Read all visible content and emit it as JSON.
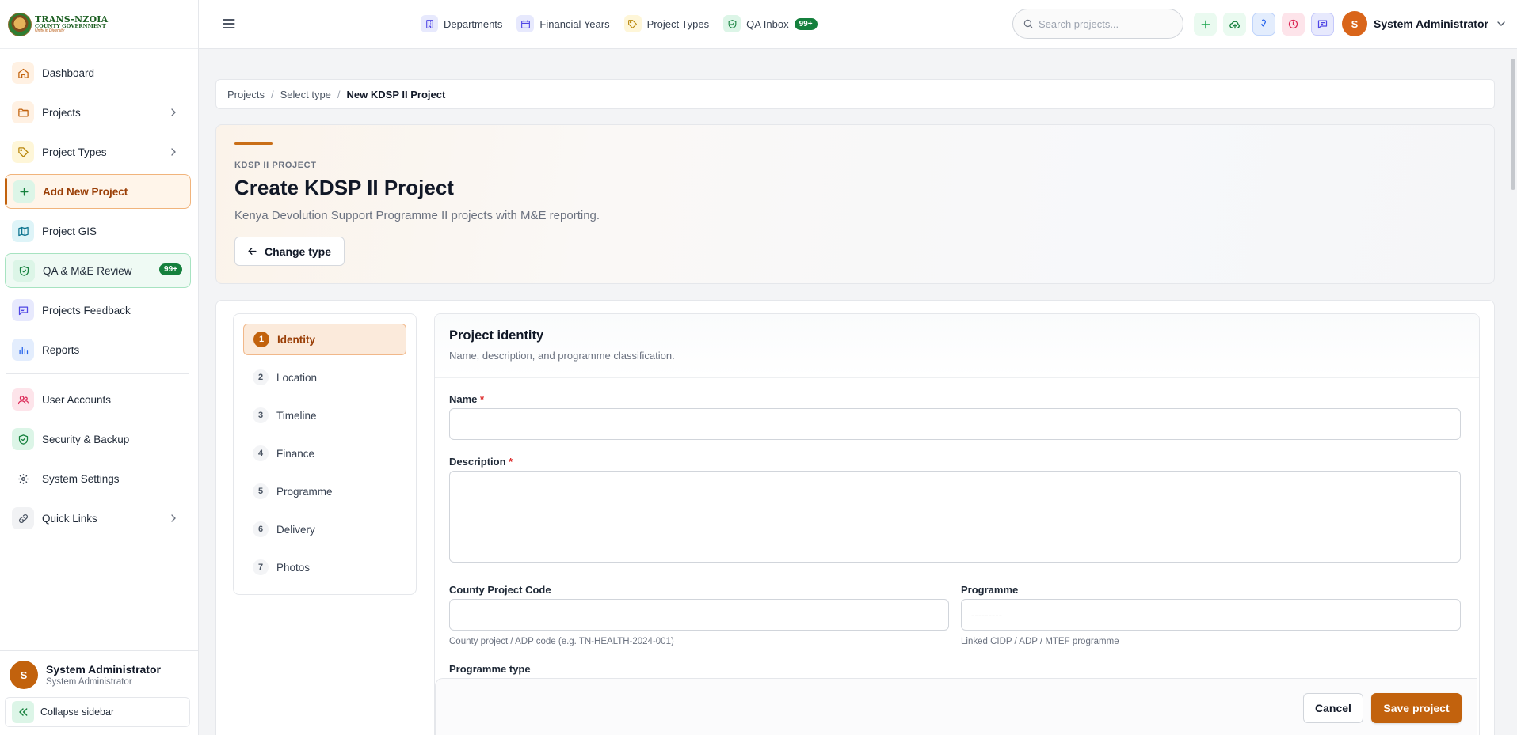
{
  "brand": {
    "line1": "TRANS-NZOIA",
    "line2": "COUNTY GOVERNMENT",
    "line3": "Unity in Diversity"
  },
  "sidebar": {
    "items": [
      {
        "label": "Dashboard",
        "icon": "home-icon"
      },
      {
        "label": "Projects",
        "icon": "folder-icon"
      },
      {
        "label": "Project Types",
        "icon": "tag-icon"
      },
      {
        "label": "Add New Project",
        "icon": "plus-icon"
      },
      {
        "label": "Project GIS",
        "icon": "map-icon"
      },
      {
        "label": "QA & M&E Review",
        "icon": "shield-check-icon",
        "badge": "99+"
      },
      {
        "label": "Projects Feedback",
        "icon": "chat-icon"
      },
      {
        "label": "Reports",
        "icon": "bar-chart-icon"
      },
      {
        "label": "User Accounts",
        "icon": "users-icon"
      },
      {
        "label": "Security & Backup",
        "icon": "shield-icon"
      },
      {
        "label": "System Settings",
        "icon": "gear-icon"
      },
      {
        "label": "Quick Links",
        "icon": "link-icon"
      }
    ],
    "user": {
      "initial": "S",
      "name": "System Administrator",
      "role": "System Administrator"
    },
    "collapse_label": "Collapse sidebar"
  },
  "topbar": {
    "links": [
      {
        "label": "Departments"
      },
      {
        "label": "Financial Years"
      },
      {
        "label": "Project Types"
      },
      {
        "label": "QA Inbox",
        "badge": "99+"
      }
    ],
    "search_placeholder": "Search projects...",
    "user": {
      "initial": "S",
      "name": "System Administrator"
    }
  },
  "breadcrumb": {
    "items": [
      "Projects",
      "Select type"
    ],
    "current": "New KDSP II Project"
  },
  "hero": {
    "kicker": "KDSP II PROJECT",
    "title": "Create KDSP II Project",
    "subtitle": "Kenya Devolution Support Programme II projects with M&E reporting.",
    "change_type_label": "Change type"
  },
  "steps": [
    {
      "num": "1",
      "label": "Identity"
    },
    {
      "num": "2",
      "label": "Location"
    },
    {
      "num": "3",
      "label": "Timeline"
    },
    {
      "num": "4",
      "label": "Finance"
    },
    {
      "num": "5",
      "label": "Programme"
    },
    {
      "num": "6",
      "label": "Delivery"
    },
    {
      "num": "7",
      "label": "Photos"
    }
  ],
  "form": {
    "section_title": "Project identity",
    "section_subtitle": "Name, description, and programme classification.",
    "name_label": "Name",
    "name_value": "",
    "description_label": "Description",
    "description_value": "",
    "required_mark": "*",
    "code_label": "County Project Code",
    "code_value": "",
    "code_hint": "County project / ADP code (e.g. TN-HEALTH-2024-001)",
    "programme_label": "Programme",
    "programme_value": "---------",
    "programme_hint": "Linked CIDP / ADP / MTEF programme",
    "programme_type_label": "Programme type"
  },
  "footer_actions": {
    "cancel_label": "Cancel",
    "save_label": "Save project"
  },
  "colors": {
    "accent": "#c2620d",
    "success": "#15803d"
  }
}
